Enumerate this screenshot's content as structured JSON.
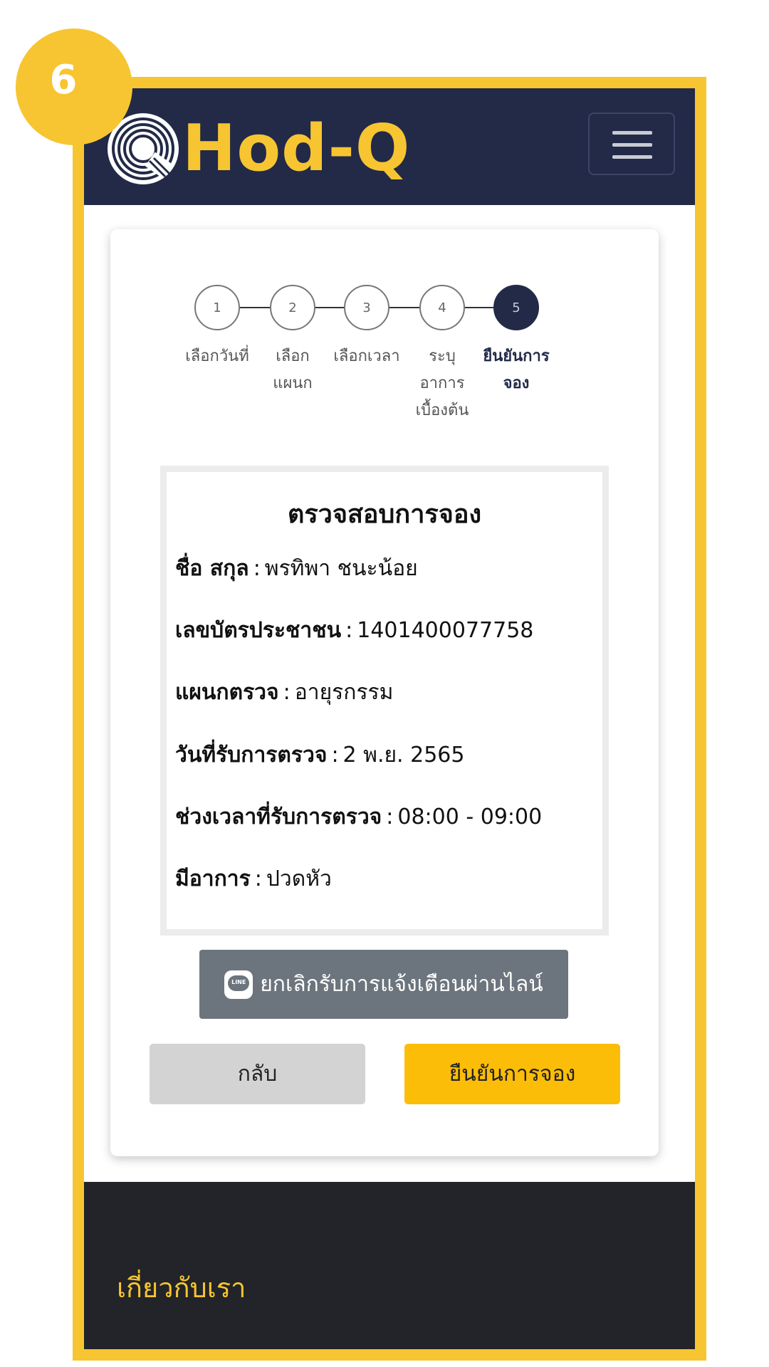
{
  "badge": {
    "number": "6"
  },
  "brand": {
    "name": "Hod-Q"
  },
  "stepper": {
    "steps": [
      {
        "number": "1",
        "label": "เลือกวันที่"
      },
      {
        "number": "2",
        "label": "เลือก\nแผนก"
      },
      {
        "number": "3",
        "label": "เลือกเวลา"
      },
      {
        "number": "4",
        "label": "ระบุ\nอาการ\nเบื้องต้น"
      },
      {
        "number": "5",
        "label": "ยืนยันการ\nจอง"
      }
    ],
    "active_step": 5
  },
  "summary": {
    "title": "ตรวจสอบการจอง",
    "separator": ":",
    "fields": [
      {
        "label": "ชื่อ สกุล",
        "value": "พรทิพา ชนะน้อย"
      },
      {
        "label": "เลขบัตรประชาชน",
        "value": "1401400077758"
      },
      {
        "label": "แผนกตรวจ",
        "value": "อายุรกรรม"
      },
      {
        "label": "วันที่รับการตรวจ",
        "value": "2 พ.ย. 2565"
      },
      {
        "label": "ช่วงเวลาที่รับการตรวจ",
        "value": "08:00 - 09:00"
      },
      {
        "label": "มีอาการ",
        "value": "ปวดหัว"
      }
    ]
  },
  "line_button": {
    "label": "ยกเลิกรับการแจ้งเตือนผ่านไลน์",
    "icon": "line-app-icon",
    "icon_text": "LINE"
  },
  "actions": {
    "back_label": "กลับ",
    "confirm_label": "ยืนยันการจอง"
  },
  "footer": {
    "about_label": "เกี่ยวกับเรา"
  },
  "colors": {
    "frame": "#f7c531",
    "navbar": "#222a48",
    "confirm": "#fbbd08",
    "back": "#d3d3d3",
    "line_button": "#6c757d",
    "footer": "#222429"
  }
}
